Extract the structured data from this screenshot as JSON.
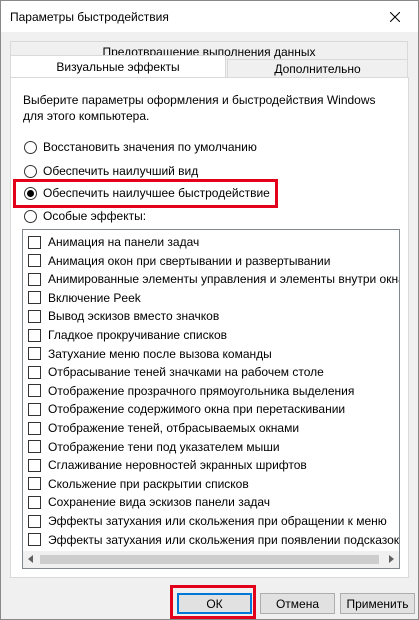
{
  "window": {
    "title": "Параметры быстродействия"
  },
  "tabs": {
    "back": [
      "Предотвращение выполнения данных"
    ],
    "front": [
      {
        "label": "Визуальные эффекты",
        "active": true
      },
      {
        "label": "Дополнительно",
        "active": false
      }
    ]
  },
  "panel": {
    "description": "Выберите параметры оформления и быстродействия Windows для этого компьютера.",
    "radios": [
      {
        "label": "Восстановить значения по умолчанию",
        "checked": false
      },
      {
        "label": "Обеспечить наилучший вид",
        "checked": false
      },
      {
        "label": "Обеспечить наилучшее быстродействие",
        "checked": true
      },
      {
        "label": "Особые эффекты:",
        "checked": false
      }
    ],
    "effects": [
      "Анимация на панели задач",
      "Анимация окон при свертывании и развертывании",
      "Анимированные элементы управления и элементы внутри окна",
      "Включение Peek",
      "Вывод эскизов вместо значков",
      "Гладкое прокручивание списков",
      "Затухание меню после вызова команды",
      "Отбрасывание теней значками на рабочем столе",
      "Отображение прозрачного прямоугольника выделения",
      "Отображение содержимого окна при перетаскивании",
      "Отображение теней, отбрасываемых окнами",
      "Отображение тени под указателем мыши",
      "Сглаживание неровностей экранных шрифтов",
      "Скольжение при раскрытии списков",
      "Сохранение вида эскизов панели задач",
      "Эффекты затухания или скольжения при обращении к меню",
      "Эффекты затухания или скольжения при появлении подсказок"
    ]
  },
  "buttons": {
    "ok": "ОК",
    "cancel": "Отмена",
    "apply": "Применить"
  },
  "colors": {
    "highlight": "#e2001a",
    "focus": "#0078d7"
  }
}
